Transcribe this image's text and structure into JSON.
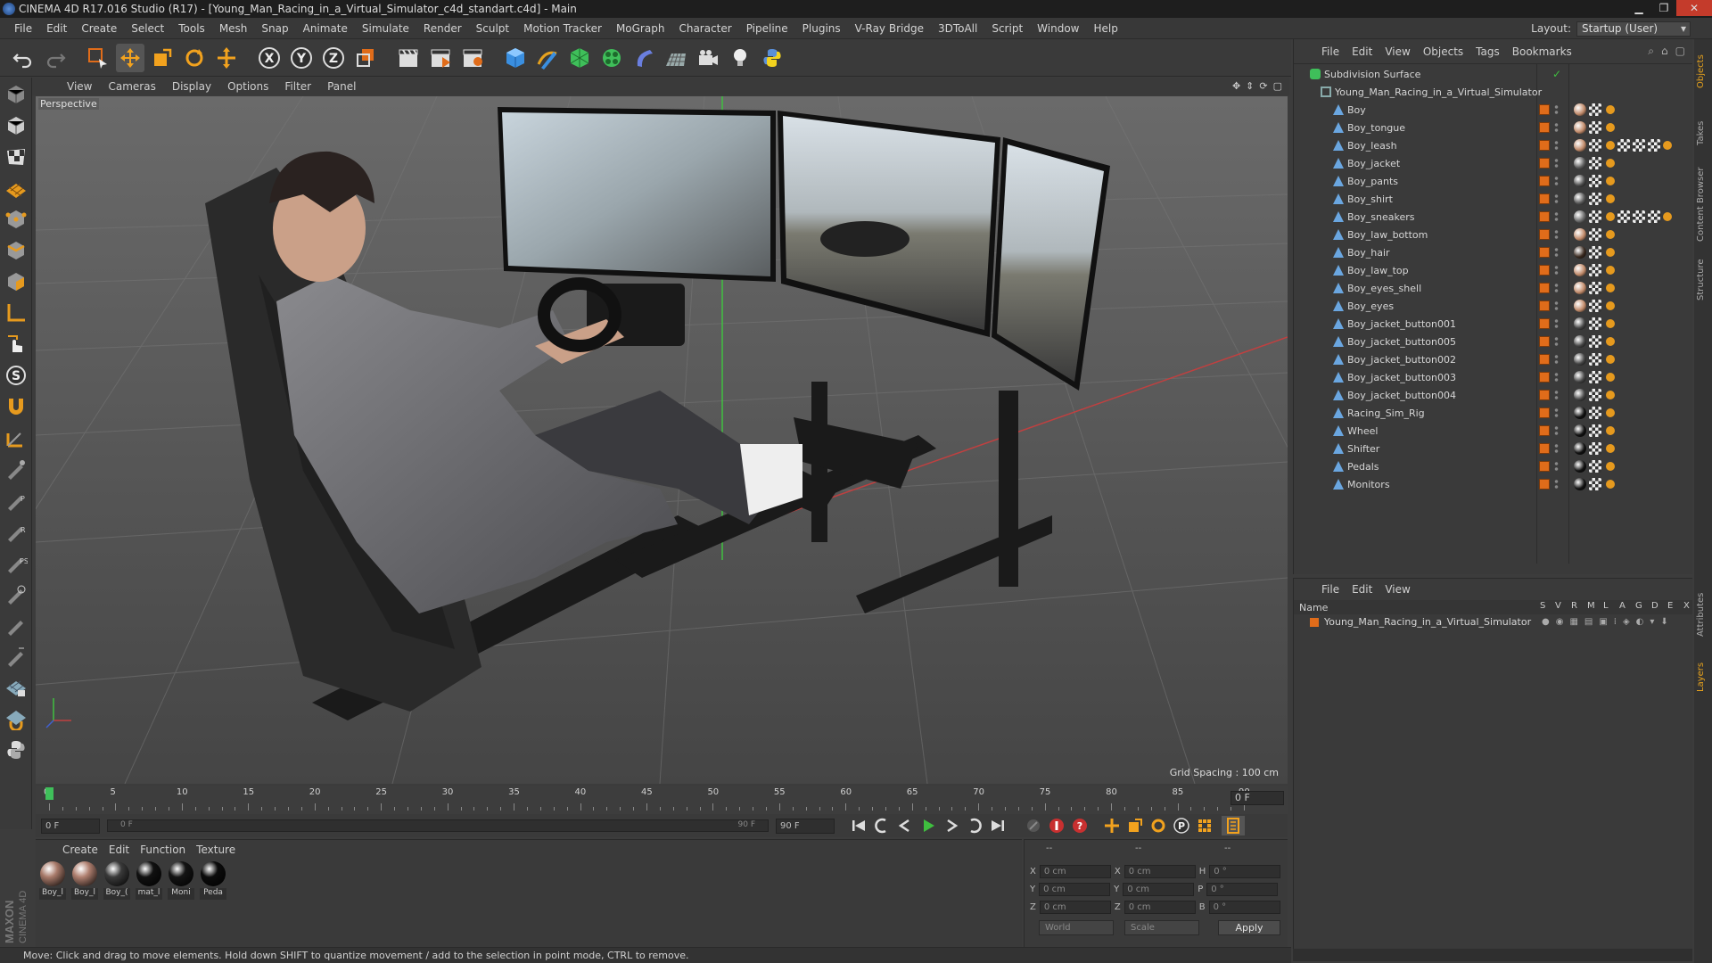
{
  "window": {
    "title": "CINEMA 4D R17.016 Studio (R17) - [Young_Man_Racing_in_a_Virtual_Simulator_c4d_standart.c4d] - Main"
  },
  "menubar": {
    "items": [
      "File",
      "Edit",
      "Create",
      "Select",
      "Tools",
      "Mesh",
      "Snap",
      "Animate",
      "Simulate",
      "Render",
      "Sculpt",
      "Motion Tracker",
      "MoGraph",
      "Character",
      "Pipeline",
      "Plugins",
      "V-Ray Bridge",
      "3DToAll",
      "Script",
      "Window",
      "Help"
    ],
    "layout_label": "Layout:",
    "layout_value": "Startup (User)"
  },
  "viewport": {
    "menu": [
      "View",
      "Cameras",
      "Display",
      "Options",
      "Filter",
      "Panel"
    ],
    "label": "Perspective",
    "grid_spacing": "Grid Spacing : 100 cm"
  },
  "timeline": {
    "ticks": [
      "0",
      "5",
      "10",
      "15",
      "20",
      "25",
      "30",
      "35",
      "40",
      "45",
      "50",
      "55",
      "60",
      "65",
      "70",
      "75",
      "80",
      "85",
      "90"
    ],
    "current_frame": "0 F",
    "start_field": "0 F",
    "range_start": "0 F",
    "range_end": "90 F",
    "end_field": "90 F"
  },
  "materials": {
    "menu": [
      "Create",
      "Edit",
      "Function",
      "Texture"
    ],
    "items": [
      {
        "label": "Boy_l",
        "color": "#a87a6a"
      },
      {
        "label": "Boy_l",
        "color": "#b08070"
      },
      {
        "label": "Boy_(",
        "color": "#3a3a3a"
      },
      {
        "label": "mat_l",
        "color": "#111111"
      },
      {
        "label": "Moni",
        "color": "#141414"
      },
      {
        "label": "Peda",
        "color": "#0c0c0c"
      }
    ]
  },
  "coords": {
    "header": [
      "--",
      "--",
      "--"
    ],
    "rows": [
      {
        "a": "X",
        "av": "0 cm",
        "b": "X",
        "bv": "0 cm",
        "c": "H",
        "cv": "0 °"
      },
      {
        "a": "Y",
        "av": "0 cm",
        "b": "Y",
        "bv": "0 cm",
        "c": "P",
        "cv": "0 °"
      },
      {
        "a": "Z",
        "av": "0 cm",
        "b": "Z",
        "bv": "0 cm",
        "c": "B",
        "cv": "0 °"
      }
    ],
    "world": "World",
    "scale": "Scale",
    "apply": "Apply"
  },
  "status": {
    "text": "Move: Click and drag to move elements. Hold down SHIFT to quantize movement / add to the selection in point mode, CTRL to remove."
  },
  "objects": {
    "menu": [
      "File",
      "Edit",
      "View",
      "Objects",
      "Tags",
      "Bookmarks"
    ],
    "root": "Subdivision Surface",
    "group": "Young_Man_Racing_in_a_Virtual_Simulator",
    "items": [
      {
        "name": "Boy",
        "tag": "#c08a6a"
      },
      {
        "name": "Boy_tongue",
        "tag": "#c08a6a"
      },
      {
        "name": "Boy_leash",
        "tag": "#c08a6a"
      },
      {
        "name": "Boy_jacket",
        "tag": "#5a5a5a"
      },
      {
        "name": "Boy_pants",
        "tag": "#4a4a4a"
      },
      {
        "name": "Boy_shirt",
        "tag": "#555555"
      },
      {
        "name": "Boy_sneakers",
        "tag": "#6a6a6a"
      },
      {
        "name": "Boy_law_bottom",
        "tag": "#c08a6a"
      },
      {
        "name": "Boy_hair",
        "tag": "#3a2a20"
      },
      {
        "name": "Boy_law_top",
        "tag": "#c08a6a"
      },
      {
        "name": "Boy_eyes_shell",
        "tag": "#c08a6a"
      },
      {
        "name": "Boy_eyes",
        "tag": "#c08a6a"
      },
      {
        "name": "Boy_jacket_button001",
        "tag": "#444444"
      },
      {
        "name": "Boy_jacket_button005",
        "tag": "#444444"
      },
      {
        "name": "Boy_jacket_button002",
        "tag": "#444444"
      },
      {
        "name": "Boy_jacket_button003",
        "tag": "#444444"
      },
      {
        "name": "Boy_jacket_button004",
        "tag": "#444444"
      },
      {
        "name": "Racing_Sim_Rig",
        "tag": "#111111"
      },
      {
        "name": "Wheel",
        "tag": "#111111"
      },
      {
        "name": "Shifter",
        "tag": "#111111"
      },
      {
        "name": "Pedals",
        "tag": "#111111"
      },
      {
        "name": "Monitors",
        "tag": "#111111"
      }
    ]
  },
  "layers": {
    "menu": [
      "File",
      "Edit",
      "View"
    ],
    "header_name": "Name",
    "columns": [
      "S",
      "V",
      "R",
      "M",
      "L",
      "A",
      "G",
      "D",
      "E",
      "X"
    ],
    "row": "Young_Man_Racing_in_a_Virtual_Simulator"
  },
  "sidetabs": [
    "Objects",
    "Takes",
    "Content Browser",
    "Structure",
    "Attributes",
    "Layers"
  ],
  "brand": {
    "maxon": "MAXON",
    "c4d": "CINEMA 4D"
  },
  "colors": {
    "accent": "#e06c1a",
    "axis_x": "#d04040",
    "axis_y": "#40c040"
  }
}
